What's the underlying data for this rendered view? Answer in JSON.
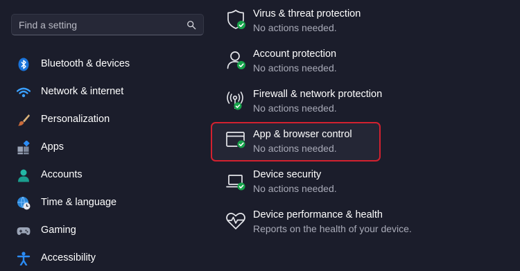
{
  "search": {
    "placeholder": "Find a setting"
  },
  "nav": {
    "items": [
      {
        "label": "Bluetooth & devices",
        "icon": "bluetooth-icon"
      },
      {
        "label": "Network & internet",
        "icon": "wifi-icon"
      },
      {
        "label": "Personalization",
        "icon": "brush-icon"
      },
      {
        "label": "Apps",
        "icon": "apps-icon"
      },
      {
        "label": "Accounts",
        "icon": "person-icon"
      },
      {
        "label": "Time & language",
        "icon": "globe-clock-icon"
      },
      {
        "label": "Gaming",
        "icon": "gamepad-icon"
      },
      {
        "label": "Accessibility",
        "icon": "accessibility-icon"
      }
    ]
  },
  "protection": {
    "items": [
      {
        "title": "Virus & threat protection",
        "status": "No actions needed.",
        "icon": "shield-icon"
      },
      {
        "title": "Account protection",
        "status": "No actions needed.",
        "icon": "account-protection-icon"
      },
      {
        "title": "Firewall & network protection",
        "status": "No actions needed.",
        "icon": "firewall-antenna-icon"
      },
      {
        "title": "App & browser control",
        "status": "No actions needed.",
        "icon": "app-browser-window-icon",
        "highlighted": true
      },
      {
        "title": "Device security",
        "status": "No actions needed.",
        "icon": "laptop-icon"
      },
      {
        "title": "Device performance & health",
        "status": "Reports on the health of your device.",
        "icon": "heart-icon"
      }
    ]
  },
  "colors": {
    "background": "#1b1d2b",
    "highlight_border": "#d3212f",
    "status_ok": "#16a34a",
    "accent_blue": "#1e88e5"
  }
}
